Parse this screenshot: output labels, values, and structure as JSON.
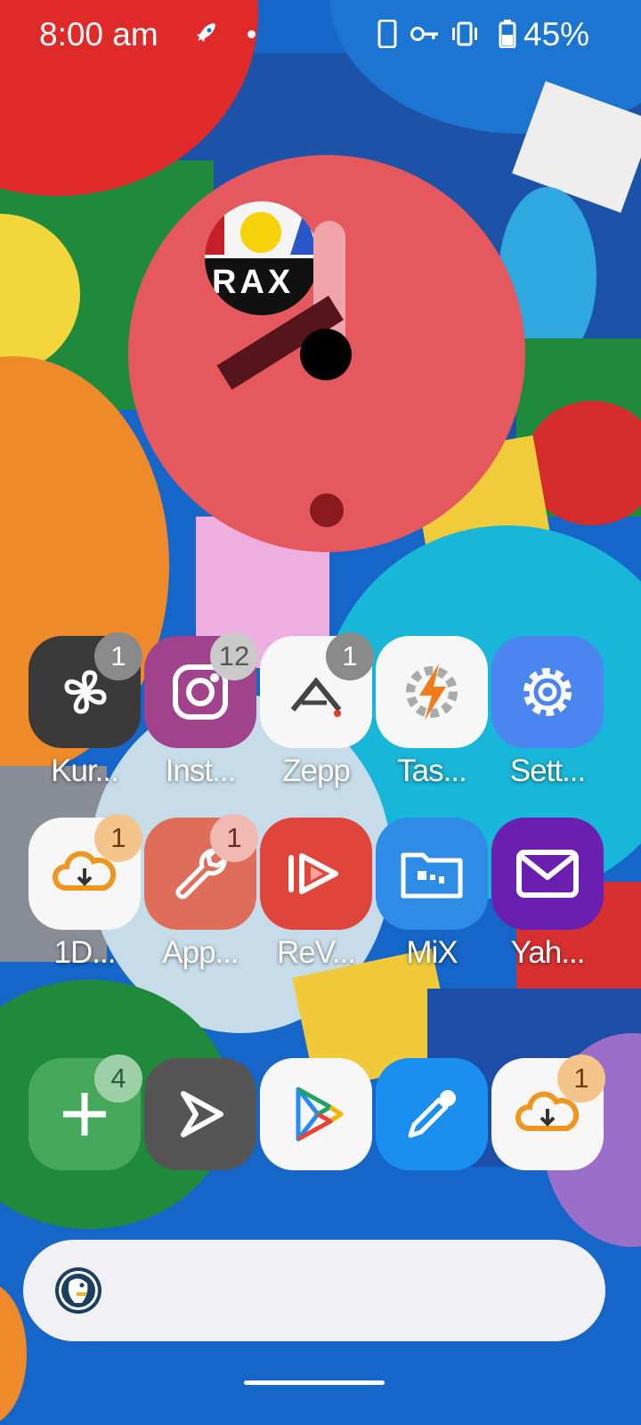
{
  "status_bar": {
    "time": "8:00 am",
    "battery_percent": "45%",
    "icons": [
      "rocket-icon",
      "notification-dot-icon",
      "phone-icon",
      "vpn-key-icon",
      "vibrate-icon",
      "battery-icon"
    ]
  },
  "clock_widget": {
    "album_art_text": "RAX",
    "hour_hand_color": "#55151a",
    "minute_hand_color": "#eea4a8",
    "face_color": "#e4585e"
  },
  "apps_row1": [
    {
      "label": "Kur...",
      "badge": "1",
      "icon": "clover-icon",
      "bg": "#3a3a3a"
    },
    {
      "label": "Inst...",
      "badge": "12",
      "icon": "instagram-icon",
      "bg": "#a1428c"
    },
    {
      "label": "Zepp",
      "badge": "1",
      "icon": "zepp-icon",
      "bg": "#f7f7f7"
    },
    {
      "label": "Tas...",
      "badge": "",
      "icon": "tasker-icon",
      "bg": "#f7f7f7"
    },
    {
      "label": "Sett...",
      "badge": "",
      "icon": "gear-icon",
      "bg": "#4b86f0"
    }
  ],
  "apps_row2": [
    {
      "label": "1D...",
      "badge": "1",
      "icon": "cloud-download-icon",
      "bg": "#f7f7f7"
    },
    {
      "label": "App...",
      "badge": "1",
      "icon": "wrench-icon",
      "bg": "#de6e5a"
    },
    {
      "label": "ReV...",
      "badge": "",
      "icon": "revanced-icon",
      "bg": "#e0453c"
    },
    {
      "label": "MiX",
      "badge": "",
      "icon": "folder-icon",
      "bg": "#2e8be6"
    },
    {
      "label": "Yah...",
      "badge": "",
      "icon": "mail-icon",
      "bg": "#6a1fb0"
    }
  ],
  "dock": [
    {
      "badge": "4",
      "icon": "plus-icon",
      "bg": "#45a85a"
    },
    {
      "badge": "",
      "icon": "send-arrow-icon",
      "bg": "#555555"
    },
    {
      "badge": "",
      "icon": "play-store-icon",
      "bg": "#f7f7f7"
    },
    {
      "badge": "",
      "icon": "eyedropper-icon",
      "bg": "#1a8ff0"
    },
    {
      "badge": "1",
      "icon": "cloud-download-icon",
      "bg": "#f7f7f7"
    }
  ],
  "search_bar": {
    "icon": "duckduckgo-icon",
    "placeholder": ""
  }
}
